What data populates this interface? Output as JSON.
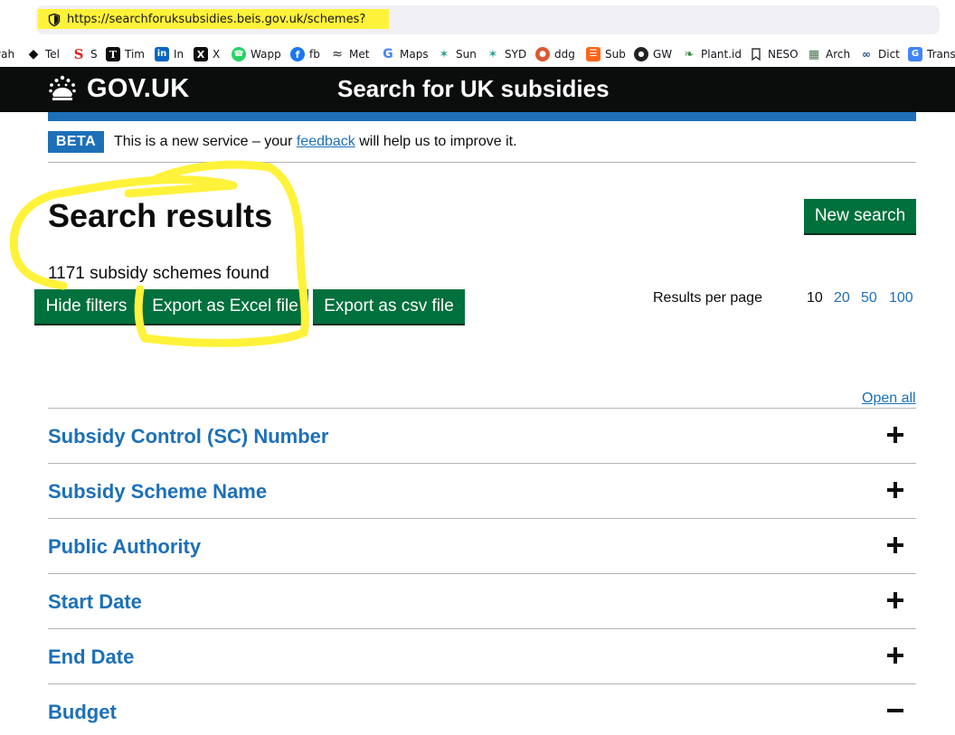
{
  "browser": {
    "url": "https://searchforuksubsidies.beis.gov.uk/schemes?",
    "bookmarks": [
      {
        "label": "vah",
        "icon": "partial-icon",
        "color": "#ffffff"
      },
      {
        "label": "Tel",
        "icon": "tel-icon",
        "color": "#0b0c0c"
      },
      {
        "label": "S",
        "icon": "s-icon",
        "color": "#e2231a"
      },
      {
        "label": "Tim",
        "icon": "times-icon",
        "color": "#0b0c0c"
      },
      {
        "label": "In",
        "icon": "linkedin-icon",
        "color": "#0a66c2"
      },
      {
        "label": "X",
        "icon": "x-icon",
        "color": "#0b0c0c"
      },
      {
        "label": "Wapp",
        "icon": "whatsapp-icon",
        "color": "#25d366"
      },
      {
        "label": "fb",
        "icon": "facebook-icon",
        "color": "#1877f2"
      },
      {
        "label": "Met",
        "icon": "met-icon",
        "color": "#555555"
      },
      {
        "label": "Maps",
        "icon": "google-icon",
        "color": "#4285f4"
      },
      {
        "label": "Sun",
        "icon": "sun-icon",
        "color": "#2a9d8f"
      },
      {
        "label": "SYD",
        "icon": "syd-icon",
        "color": "#2a9d8f"
      },
      {
        "label": "ddg",
        "icon": "duckduckgo-icon",
        "color": "#de5833"
      },
      {
        "label": "Sub",
        "icon": "substack-icon",
        "color": "#ff6719"
      },
      {
        "label": "GW",
        "icon": "gw-icon",
        "color": "#222222"
      },
      {
        "label": "Plant.id",
        "icon": "plant-icon",
        "color": "#3a8a3a"
      },
      {
        "label": "NESO",
        "icon": "bookmark-icon",
        "color": "#333333"
      },
      {
        "label": "Arch",
        "icon": "arch-icon",
        "color": "#4a7a4a"
      },
      {
        "label": "Dict",
        "icon": "dict-icon",
        "color": "#1d4f91"
      },
      {
        "label": "Trans",
        "icon": "translate-icon",
        "color": "#4285f4"
      }
    ]
  },
  "header": {
    "logo": "GOV.UK",
    "service_name": "Search for UK subsidies"
  },
  "phase_banner": {
    "tag": "BETA",
    "text_before": "This is a new service – your ",
    "link": "feedback",
    "text_after": " will help us to improve it."
  },
  "main": {
    "title": "Search results",
    "results_count": "1171 subsidy schemes found",
    "new_search": "New search",
    "hide_filters": "Hide filters",
    "export_excel": "Export as Excel file",
    "export_csv": "Export as csv file",
    "results_per_page_label": "Results per page",
    "results_per_page_options": [
      "10",
      "20",
      "50",
      "100"
    ],
    "results_per_page_selected": "10"
  },
  "accordion": {
    "open_all": "Open all",
    "sections": [
      {
        "heading": "Subsidy Control (SC) Number",
        "expanded": false
      },
      {
        "heading": "Subsidy Scheme Name",
        "expanded": false
      },
      {
        "heading": "Public Authority",
        "expanded": false
      },
      {
        "heading": "Start Date",
        "expanded": false
      },
      {
        "heading": "End Date",
        "expanded": false
      },
      {
        "heading": "Budget",
        "expanded": true
      }
    ]
  },
  "colors": {
    "govuk_blue": "#1d70b8",
    "govuk_green": "#00703c",
    "annotation_yellow": "#fff23a"
  }
}
